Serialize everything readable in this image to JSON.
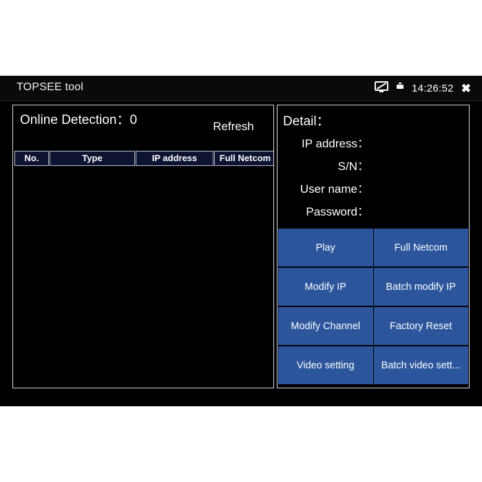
{
  "titlebar": {
    "app_title": "TOPSEE tool",
    "screen_icon": "monitor-off-icon",
    "minimize_icon": "minimize-icon",
    "clock": "14:26:52",
    "close_label": "✖"
  },
  "left_panel": {
    "online_detection_label": "Online Detection：0",
    "refresh_label": "Refresh",
    "table": {
      "columns": [
        "No.",
        "Type",
        "IP address",
        "Full Netcom"
      ],
      "rows": []
    }
  },
  "right_panel": {
    "detail_title": "Detail：",
    "fields": [
      {
        "label": "IP address：",
        "value": ""
      },
      {
        "label": "S/N：",
        "value": ""
      },
      {
        "label": "User name：",
        "value": ""
      },
      {
        "label": "Password：",
        "value": ""
      }
    ],
    "buttons": [
      "Play",
      "Full Netcom",
      "Modify IP",
      "Batch modify IP",
      "Modify Channel",
      "Factory Reset",
      "Video setting",
      "Batch video sett..."
    ]
  },
  "colors": {
    "accent_blue": "#2c559b",
    "header_navy": "#0d1330",
    "background": "#000000",
    "border": "#d8dce4"
  }
}
